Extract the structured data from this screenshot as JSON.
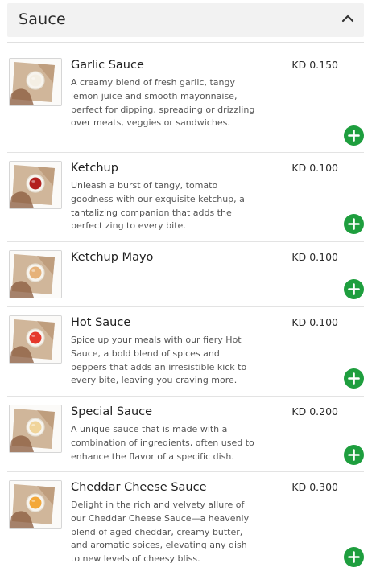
{
  "section": {
    "title": "Sauce",
    "collapse_icon": "chevron-up-icon"
  },
  "items": [
    {
      "name": "Garlic Sauce",
      "price": "KD 0.150",
      "description": "A creamy blend of fresh garlic, tangy lemon juice and smooth mayonnaise, perfect for dipping, spreading or drizzling over meats, veggies or sandwiches.",
      "sauce_color": "#f4efe4"
    },
    {
      "name": "Ketchup",
      "price": "KD 0.100",
      "description": "Unleash a burst of tangy, tomato goodness with our exquisite ketchup, a tantalizing companion that adds the perfect zing to every bite.",
      "sauce_color": "#b3201e"
    },
    {
      "name": "Ketchup Mayo",
      "price": "KD 0.100",
      "description": "",
      "sauce_color": "#e6b27a"
    },
    {
      "name": "Hot Sauce",
      "price": "KD 0.100",
      "description": "Spice up your meals with our fiery Hot Sauce, a bold blend of spices and peppers that adds an irresistible kick to every bite, leaving you craving more.",
      "sauce_color": "#e5382c"
    },
    {
      "name": "Special Sauce",
      "price": "KD 0.200",
      "description": "A unique sauce that is made with a combination of ingredients, often used to enhance the flavor of a specific dish.",
      "sauce_color": "#f0d49a"
    },
    {
      "name": "Cheddar Cheese Sauce",
      "price": "KD 0.300",
      "description": "Delight in the rich and velvety allure of our Cheddar Cheese Sauce—a heavenly blend of aged cheddar, creamy butter, and aromatic spices, elevating any dish to new levels of cheesy bliss.",
      "sauce_color": "#f3a83a"
    }
  ],
  "colors": {
    "accent_green": "#1e9e3e",
    "header_bg": "#f2f2f2",
    "bag_kraft": "#c8a98a"
  },
  "icons": {
    "add": "plus-icon",
    "thumbnail": "sauce-cup-image"
  }
}
